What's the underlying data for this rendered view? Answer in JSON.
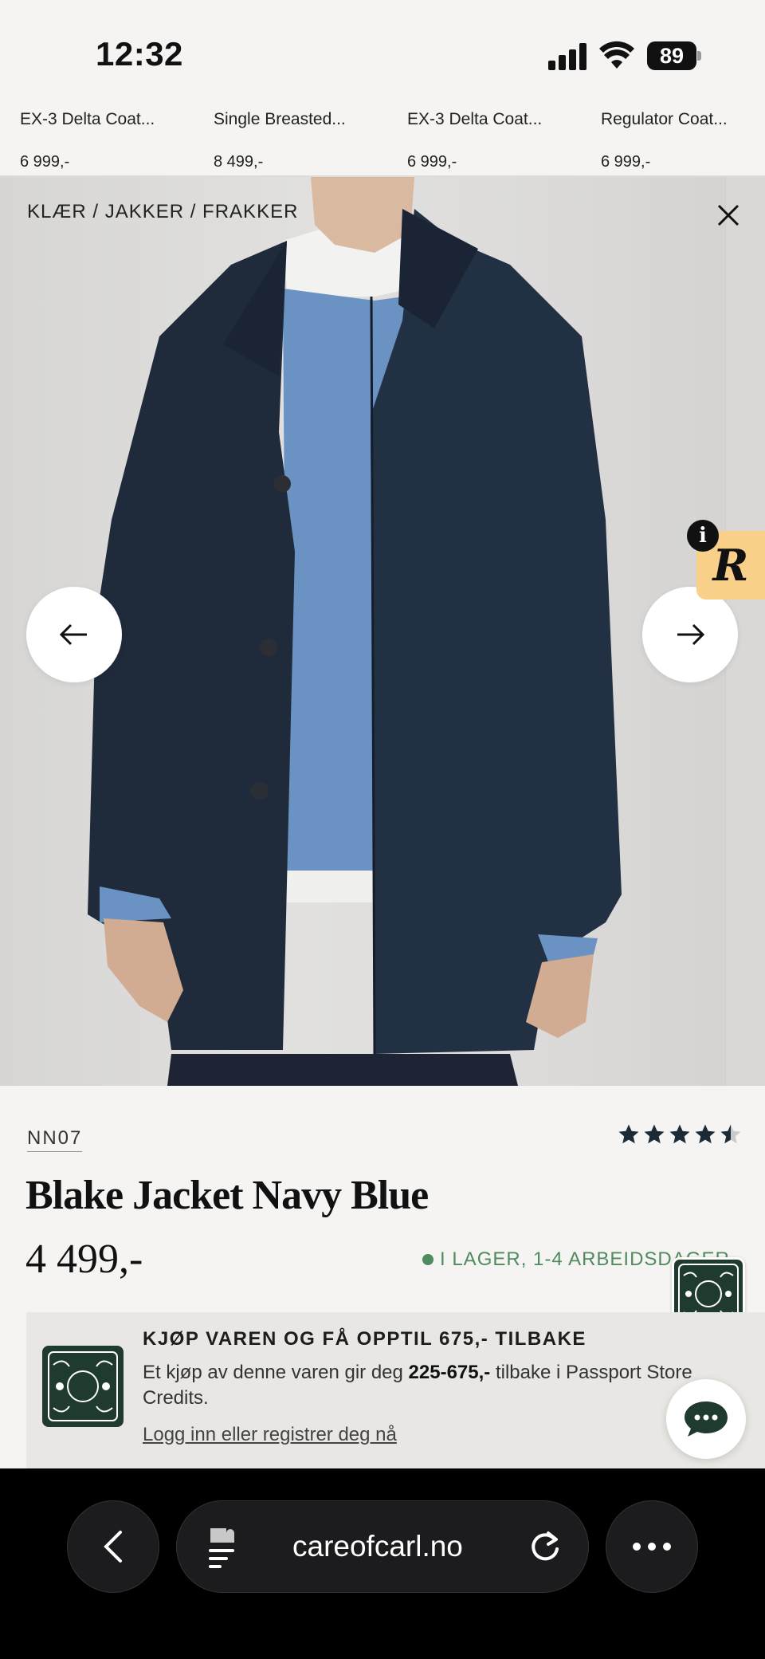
{
  "status_bar": {
    "time": "12:32",
    "battery": "89"
  },
  "product_strip": [
    {
      "name": "EX-3 Delta Coat...",
      "price": "6 999,-"
    },
    {
      "name": "Single Breasted...",
      "price": "8 499,-"
    },
    {
      "name": "EX-3 Delta Coat...",
      "price": "6 999,-"
    },
    {
      "name": "Regulator Coat...",
      "price": "6 999,-"
    }
  ],
  "hero": {
    "breadcrumb": "KLÆR / JAKKER / FRAKKER",
    "badge_label": "R",
    "info_label": "i"
  },
  "product": {
    "brand": "NN07",
    "rating": 4.5,
    "title": "Blake Jacket Navy Blue",
    "price": "4 499,-",
    "stock": "I LAGER, 1-4 ARBEIDSDAGER"
  },
  "promo": {
    "heading": "KJØP VAREN OG FÅ OPPTIL 675,- TILBAKE",
    "text_before": "Et kjøp av denne varen gir deg ",
    "text_bold": "225-675,-",
    "text_after": " tilbake i Passport Store Credits.",
    "link": "Logg inn eller registrer deg nå"
  },
  "browser": {
    "url": "careofcarl.no"
  },
  "colors": {
    "background": "#f5f4f2",
    "brand_green": "#1f3a2e",
    "stock_green": "#4e8b5f",
    "badge_yellow": "#f8d08a"
  }
}
